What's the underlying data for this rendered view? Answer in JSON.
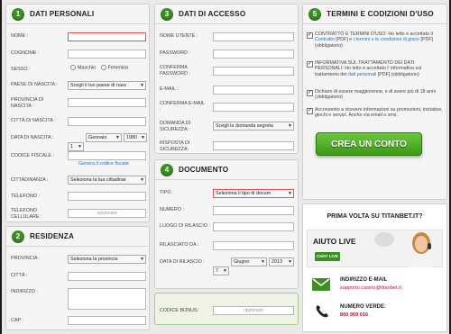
{
  "sections": {
    "personali": {
      "num": "1",
      "title": "DATI PERSONALI"
    },
    "residenza": {
      "num": "2",
      "title": "RESIDENZA"
    },
    "accesso": {
      "num": "3",
      "title": "DATI DI ACCESSO"
    },
    "documento": {
      "num": "4",
      "title": "DOCUMENTO"
    },
    "termini": {
      "num": "5",
      "title": "TERMINI E CODIZIONI D'USO"
    }
  },
  "personali": {
    "nome": "NOME :",
    "cognome": "COGNOME :",
    "sesso": "SESSO :",
    "maschio": "Maschio",
    "femmina": "Femmina",
    "paese": "PAESE DI NASCITA :",
    "paese_sel": "Scegli il tuo paese di nasc",
    "provincia": "PROVINCIA DI NASCITA :",
    "citta": "CITTÀ DI NASCITA :",
    "data": "DATA DI NASCITA :",
    "mese": "Gennaio",
    "anno": "1980",
    "giorno": "1",
    "codice": "CODICE FISCALE :",
    "genera": "Genera il codice fiscale",
    "cittadinanza": "CITTADINANZA :",
    "cittadinanza_sel": "Seleziona la tua cittadinar",
    "telefono": "TELEFONO :",
    "cellulare": "TELEFONO CELLULARE :",
    "opzionale": "opzionale"
  },
  "residenza": {
    "provincia": "PROVINCIA :",
    "provincia_sel": "Seleziona la provincia",
    "citta": "CITTÀ :",
    "indirizzo": "INDIRIZZO :",
    "cap": "CAP :"
  },
  "accesso": {
    "utente": "NOME UTENTE :",
    "password": "PASSWORD :",
    "conferma_pw": "CONFERMA PASSWORD :",
    "email": "E-MAIL :",
    "conferma_email": "CONFERMA E-MAIL :",
    "domanda": "DOMANDA DI SICUREZZA:",
    "domanda_sel": "Scegli la domanda segreta",
    "risposta": "RISPOSTA DI SICUREZZA:"
  },
  "documento": {
    "tipo": "TIPO :",
    "tipo_sel": "Seleziona il tipo di docum",
    "numero": "NUMERO :",
    "luogo": "LUOGO DI RILASCIO :",
    "rilasciato": "RILASCIATO DA :",
    "data": "DATA DI RILASCIO :",
    "mese": "Giugno",
    "anno": "2013",
    "giorno": "7",
    "bonus": "CODICE BONUS:",
    "opzionale": "opzionale"
  },
  "termini": {
    "t1a": "CONTRATTO E TERMINI D'USO: Ho letto e accettato il ",
    "t1b": "Contratto",
    "t1c": " [PDF] e i ",
    "t1d": "termini e le condizioni di gioco",
    "t1e": " [PDF] (obbligatorio)",
    "t2a": "INFORMATIVA SUL TRATTAMENTO DEI DATI PERSONALI: Ho letto e accettato l' informativa sul trattamento dei ",
    "t2b": "dati personali",
    "t2c": " [PDF] (obbligatorio)",
    "t3": "Dichiaro di essere maggiorenne, e di avere più di 18 anni (obbligatorio)",
    "t4": "Acconsento a ricevere informazioni su promozioni, iniziative, giochi e servizi. Anche via email o sms.",
    "crea": "CREA UN CONTO"
  },
  "promo": {
    "title": "PRIMA VOLTA SU TITANBET.IT?",
    "aiuto": "AIUTO LIVE",
    "chat": "CHAT LIVE",
    "email_lbl": "INDIRIZZO E-MAIL",
    "email": "supporto.casino@titanbet.it",
    "phone_lbl": "NUMERO VERDE:",
    "phone": "800 969 016"
  },
  "colors": {
    "accent": "#3b8f22",
    "link": "#2a6fbf",
    "promo_red": "#c8102e"
  }
}
